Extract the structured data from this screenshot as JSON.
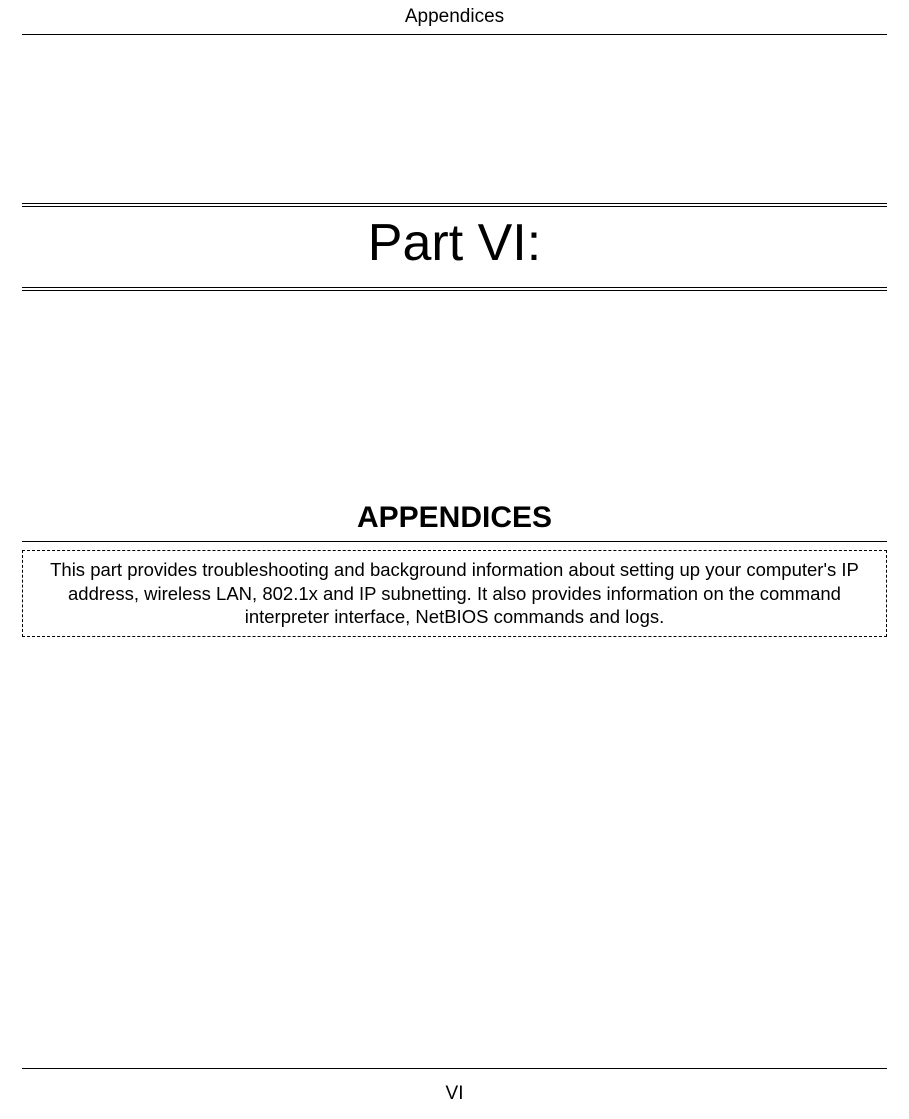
{
  "header": {
    "title": "Appendices"
  },
  "partTitle": "Part VI:",
  "sectionHeading": "APPENDICES",
  "description": "This part provides troubleshooting and background information about setting up your computer's IP address, wireless LAN, 802.1x and IP subnetting. It also provides information on the command interpreter interface, NetBIOS commands and logs.",
  "footer": {
    "pageLabel": "VI"
  }
}
